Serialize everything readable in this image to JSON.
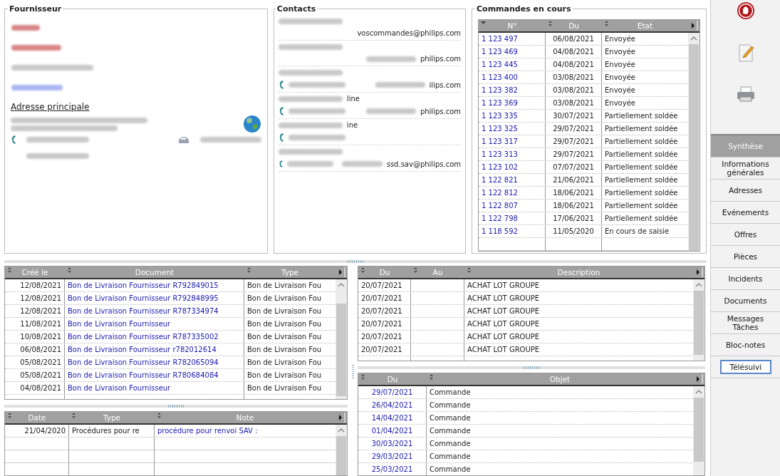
{
  "supplier": {
    "title": "Fournisseur",
    "address_heading": "Adresse principale"
  },
  "contacts": {
    "title": "Contacts",
    "items": [
      {
        "phone": false,
        "email": "voscommandes@philips.com"
      },
      {
        "phone": false,
        "email": "philips.com"
      },
      {
        "phone": true,
        "email": "ilips.com"
      },
      {
        "name_tail": "line",
        "phone": true,
        "email": "philips.com"
      },
      {
        "name_tail": "ine",
        "phone": true
      },
      {
        "phone": true,
        "email": "ssd.sav@philips.com"
      }
    ]
  },
  "orders": {
    "title": "Commandes en cours",
    "columns": [
      {
        "label": "N°",
        "kind": "link",
        "sorted": true
      },
      {
        "label": "Du",
        "kind": "text",
        "sorted": false
      },
      {
        "label": "Etat",
        "kind": "text",
        "sorted": false
      }
    ],
    "rows": [
      [
        "1 123 497",
        "06/08/2021",
        "Envoyée"
      ],
      [
        "1 123 469",
        "04/08/2021",
        "Envoyée"
      ],
      [
        "1 123 445",
        "04/08/2021",
        "Envoyée"
      ],
      [
        "1 123 400",
        "03/08/2021",
        "Envoyée"
      ],
      [
        "1 123 382",
        "03/08/2021",
        "Envoyée"
      ],
      [
        "1 123 369",
        "03/08/2021",
        "Envoyée"
      ],
      [
        "1 123 335",
        "30/07/2021",
        "Partiellement soldée"
      ],
      [
        "1 123 325",
        "29/07/2021",
        "Partiellement soldée"
      ],
      [
        "1 123 317",
        "29/07/2021",
        "Partiellement soldée"
      ],
      [
        "1 123 313",
        "29/07/2021",
        "Partiellement soldée"
      ],
      [
        "1 123 102",
        "07/07/2021",
        "Partiellement soldée"
      ],
      [
        "1 122 821",
        "21/06/2021",
        "Partiellement soldée"
      ],
      [
        "1 122 812",
        "18/06/2021",
        "Partiellement soldée"
      ],
      [
        "1 122 807",
        "18/06/2021",
        "Partiellement soldée"
      ],
      [
        "1 122 798",
        "17/06/2021",
        "Partiellement soldée"
      ],
      [
        "1 118 592",
        "11/05/2020",
        "En cours de saisie"
      ]
    ]
  },
  "documents": {
    "columns": [
      {
        "label": "Créé le",
        "kind": "text",
        "sorted": false
      },
      {
        "label": "Document",
        "kind": "link",
        "sorted": false
      },
      {
        "label": "Type",
        "kind": "text",
        "sorted": false
      }
    ],
    "rows": [
      [
        "12/08/2021",
        "Bon de Livraison Fournisseur R792849015",
        "Bon de Livraison Fou"
      ],
      [
        "12/08/2021",
        "Bon de Livraison Fournisseur R792848995",
        "Bon de Livraison Fou"
      ],
      [
        "12/08/2021",
        "Bon de Livraison Fournisseur R787334974",
        "Bon de Livraison Fou"
      ],
      [
        "11/08/2021",
        "Bon de Livraison Fournisseur",
        "Bon de Livraison Fou"
      ],
      [
        "10/08/2021",
        "Bon de Livraison Fournisseur R787335002",
        "Bon de Livraison Fou"
      ],
      [
        "06/08/2021",
        "Bon de Livraison Fournisseur r782012614",
        "Bon de Livraison Fou"
      ],
      [
        "05/08/2021",
        "Bon de Livraison Fournisseur R782065094",
        "Bon de Livraison Fou"
      ],
      [
        "05/08/2021",
        "Bon de Livraison Fournisseur R780684084",
        "Bon de Livraison Fou"
      ],
      [
        "04/08/2021",
        "Bon de Livraison Fournisseur",
        "Bon de Livraison Fou"
      ]
    ]
  },
  "notes": {
    "columns": [
      {
        "label": "Date",
        "kind": "text",
        "sorted": false
      },
      {
        "label": "Type",
        "kind": "text",
        "sorted": false
      },
      {
        "label": "Note",
        "kind": "link",
        "sorted": false
      }
    ],
    "rows": [
      [
        "21/04/2020",
        "Procédures pour re",
        "procédure pour renvoi SAV :"
      ]
    ]
  },
  "events": {
    "columns": [
      {
        "label": "Du",
        "kind": "text",
        "sorted": false
      },
      {
        "label": "Au",
        "kind": "text",
        "sorted": false
      },
      {
        "label": "Description",
        "kind": "text",
        "sorted": false
      }
    ],
    "rows": [
      [
        "20/07/2021",
        "",
        "ACHAT LOT GROUPE"
      ],
      [
        "20/07/2021",
        "",
        "ACHAT LOT GROUPE"
      ],
      [
        "20/07/2021",
        "",
        "ACHAT LOT GROUPE"
      ],
      [
        "20/07/2021",
        "",
        "ACHAT LOT GROUPE"
      ],
      [
        "20/07/2021",
        "",
        "ACHAT LOT GROUPE"
      ],
      [
        "20/07/2021",
        "",
        "ACHAT LOT GROUPE"
      ]
    ]
  },
  "messages": {
    "columns": [
      {
        "label": "Du",
        "kind": "link",
        "sorted": false
      },
      {
        "label": "Objet",
        "kind": "text",
        "sorted": false
      }
    ],
    "rows": [
      [
        "29/07/2021",
        "Commande"
      ],
      [
        "26/04/2021",
        "Commande"
      ],
      [
        "14/04/2021",
        "Commande"
      ],
      [
        "01/04/2021",
        "Commande"
      ],
      [
        "30/03/2021",
        "Commande"
      ],
      [
        "29/03/2021",
        "Commande"
      ],
      [
        "25/03/2021",
        "Commande"
      ]
    ]
  },
  "tabs": [
    {
      "label": "Synthèse",
      "selected": true,
      "focused": false
    },
    {
      "label": "Informations générales",
      "selected": false,
      "focused": false
    },
    {
      "label": "Adresses",
      "selected": false,
      "focused": false
    },
    {
      "label": "Evénements",
      "selected": false,
      "focused": false
    },
    {
      "label": "Offres",
      "selected": false,
      "focused": false
    },
    {
      "label": "Pièces",
      "selected": false,
      "focused": false
    },
    {
      "label": "Incidents",
      "selected": false,
      "focused": false
    },
    {
      "label": "Documents",
      "selected": false,
      "focused": false
    },
    {
      "label": "Messages Tâches",
      "selected": false,
      "focused": false
    },
    {
      "label": "Bloc-notes",
      "selected": false,
      "focused": false
    },
    {
      "label": "Télésuivi",
      "selected": false,
      "focused": true
    }
  ]
}
